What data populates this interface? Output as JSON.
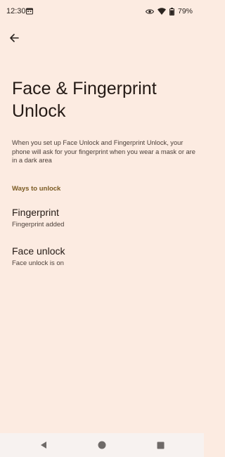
{
  "status_bar": {
    "time": "12:30",
    "battery": "79%"
  },
  "page": {
    "title": "Face & Fingerprint Unlock",
    "description": "When you set up Face Unlock and Fingerprint Unlock, your phone will ask for your fingerprint when you wear a mask or are in a dark area"
  },
  "section": {
    "header": "Ways to unlock"
  },
  "items": [
    {
      "title": "Fingerprint",
      "summary": "Fingerprint added"
    },
    {
      "title": "Face unlock",
      "summary": "Face unlock is on"
    }
  ],
  "icons": {
    "back": "arrow-back-icon",
    "status_left": "calendar-icon",
    "eye": "eye-icon",
    "wifi": "wifi-icon",
    "battery": "battery-icon",
    "nav_back": "triangle-back-icon",
    "nav_home": "circle-home-icon",
    "nav_recents": "square-recents-icon"
  },
  "colors": {
    "background": "#fcebe1",
    "accent": "#7a5a22",
    "text_primary": "#241a15",
    "nav_bar": "#f7f2f0"
  }
}
